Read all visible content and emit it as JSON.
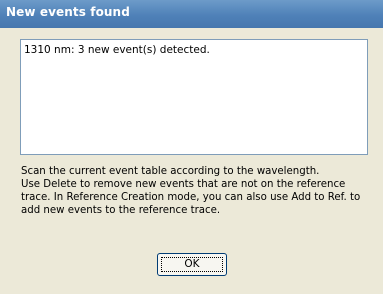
{
  "window": {
    "title": "New events found"
  },
  "event_list": {
    "items": [
      "1310 nm: 3 new event(s) detected."
    ]
  },
  "description": {
    "lines": [
      "Scan the current event table according to the wavelength.",
      "Use Delete to remove new events that are not on the reference",
      "trace. In Reference Creation mode, you can also use Add to Ref. to",
      "add new events to the reference trace."
    ]
  },
  "buttons": {
    "ok_label": "OK"
  },
  "colors": {
    "titlebar": "#4f81b8",
    "dialog_background": "#ece9d8",
    "list_border": "#7f9db9",
    "button_border": "#003c74"
  }
}
